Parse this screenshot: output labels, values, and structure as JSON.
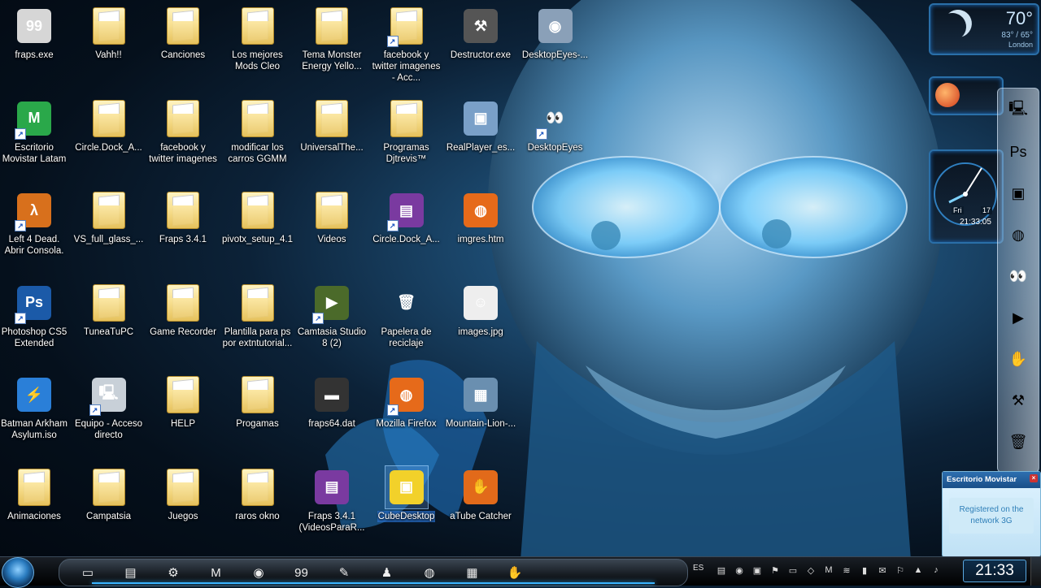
{
  "desktop": {
    "icons": [
      {
        "label": "fraps.exe",
        "kind": "app",
        "glyph": "99",
        "color": "#d6d6d6",
        "shortcut": false,
        "col": 0,
        "row": 0
      },
      {
        "label": "Vahh!!",
        "kind": "folder",
        "col": 1,
        "row": 0
      },
      {
        "label": "Canciones",
        "kind": "folder",
        "col": 2,
        "row": 0
      },
      {
        "label": "Los mejores Mods Cleo",
        "kind": "folder",
        "col": 3,
        "row": 0
      },
      {
        "label": "Tema Monster Energy Yello...",
        "kind": "folder",
        "col": 4,
        "row": 0
      },
      {
        "label": "facebook y twitter imagenes - Acc...",
        "kind": "folder",
        "shortcut": true,
        "col": 5,
        "row": 0
      },
      {
        "label": "Destructor.exe",
        "kind": "app",
        "glyph": "⚒",
        "color": "#555",
        "col": 6,
        "row": 0
      },
      {
        "label": "DesktopEyes-...",
        "kind": "app",
        "glyph": "◉",
        "color": "#8aa0b8",
        "col": 7,
        "row": 0
      },
      {
        "label": "Escritorio Movistar Latam",
        "kind": "app",
        "glyph": "M",
        "color": "#2aa84a",
        "shortcut": true,
        "col": 0,
        "row": 1
      },
      {
        "label": "Circle.Dock_A...",
        "kind": "folder",
        "col": 1,
        "row": 1
      },
      {
        "label": "facebook y twitter imagenes",
        "kind": "folder",
        "col": 2,
        "row": 1
      },
      {
        "label": "modificar los carros GGMM",
        "kind": "folder",
        "col": 3,
        "row": 1
      },
      {
        "label": "UniversalThe...",
        "kind": "folder",
        "col": 4,
        "row": 1
      },
      {
        "label": "Programas Djtrevis™",
        "kind": "folder",
        "col": 5,
        "row": 1
      },
      {
        "label": "RealPlayer_es...",
        "kind": "app",
        "glyph": "▣",
        "color": "#7aa0c8",
        "col": 6,
        "row": 1
      },
      {
        "label": "DesktopEyes",
        "kind": "app",
        "glyph": "👀",
        "color": "transparent",
        "shortcut": true,
        "col": 7,
        "row": 1
      },
      {
        "label": "Left 4 Dead. Abrir Consola.",
        "kind": "app",
        "glyph": "λ",
        "color": "#d8701c",
        "shortcut": true,
        "col": 0,
        "row": 2
      },
      {
        "label": "VS_full_glass_...",
        "kind": "folder",
        "col": 1,
        "row": 2
      },
      {
        "label": "Fraps 3.4.1",
        "kind": "folder",
        "col": 2,
        "row": 2
      },
      {
        "label": "pivotx_setup_4.1",
        "kind": "folder",
        "col": 3,
        "row": 2
      },
      {
        "label": "Videos",
        "kind": "folder",
        "col": 4,
        "row": 2
      },
      {
        "label": "Circle.Dock_A...",
        "kind": "app",
        "glyph": "▤",
        "color": "#7a3aa0",
        "shortcut": true,
        "col": 5,
        "row": 2
      },
      {
        "label": "imgres.htm",
        "kind": "app",
        "glyph": "◍",
        "color": "#e66a1a",
        "col": 6,
        "row": 2
      },
      {
        "label": "Photoshop CS5 Extended",
        "kind": "app",
        "glyph": "Ps",
        "color": "#1b5aa8",
        "shortcut": true,
        "col": 0,
        "row": 3
      },
      {
        "label": "TuneaTuPC",
        "kind": "folder",
        "col": 1,
        "row": 3
      },
      {
        "label": "Game Recorder",
        "kind": "folder",
        "col": 2,
        "row": 3
      },
      {
        "label": "Plantilla para ps por extntutorial...",
        "kind": "folder",
        "col": 3,
        "row": 3
      },
      {
        "label": "Camtasia Studio 8 (2)",
        "kind": "app",
        "glyph": "▶",
        "color": "#4b6a2a",
        "shortcut": true,
        "col": 4,
        "row": 3
      },
      {
        "label": "Papelera de reciclaje",
        "kind": "app",
        "glyph": "🗑",
        "color": "transparent",
        "col": 5,
        "row": 3
      },
      {
        "label": "images.jpg",
        "kind": "app",
        "glyph": "☺",
        "color": "#eee",
        "col": 6,
        "row": 3
      },
      {
        "label": "Batman Arkham Asylum.iso",
        "kind": "app",
        "glyph": "⚡",
        "color": "#2a7fd8",
        "col": 0,
        "row": 4
      },
      {
        "label": "Equipo - Acceso directo",
        "kind": "app",
        "glyph": "🖳",
        "color": "#c8d0d8",
        "shortcut": true,
        "col": 1,
        "row": 4
      },
      {
        "label": "HELP",
        "kind": "folder",
        "col": 2,
        "row": 4
      },
      {
        "label": "Progamas",
        "kind": "folder",
        "col": 3,
        "row": 4
      },
      {
        "label": "fraps64.dat",
        "kind": "app",
        "glyph": "▬",
        "color": "#333",
        "col": 4,
        "row": 4
      },
      {
        "label": "Mozilla Firefox",
        "kind": "app",
        "glyph": "◍",
        "color": "#e66a1a",
        "shortcut": true,
        "col": 5,
        "row": 4
      },
      {
        "label": "Mountain-Lion-...",
        "kind": "app",
        "glyph": "▦",
        "color": "#6a8fb0",
        "col": 6,
        "row": 4
      },
      {
        "label": "Animaciones",
        "kind": "folder",
        "col": 0,
        "row": 5
      },
      {
        "label": "Campatsia",
        "kind": "folder",
        "col": 1,
        "row": 5
      },
      {
        "label": "Juegos",
        "kind": "folder",
        "col": 2,
        "row": 5
      },
      {
        "label": "raros okno",
        "kind": "folder",
        "col": 3,
        "row": 5
      },
      {
        "label": "Fraps 3.4.1 (VideosParaR...",
        "kind": "app",
        "glyph": "▤",
        "color": "#7a3aa0",
        "col": 4,
        "row": 5
      },
      {
        "label": "CubeDesktop",
        "kind": "app",
        "glyph": "▣",
        "color": "#f2d12a",
        "selected": true,
        "col": 5,
        "row": 5
      },
      {
        "label": "aTube Catcher",
        "kind": "app",
        "glyph": "✋",
        "color": "#e26a1a",
        "col": 6,
        "row": 5
      }
    ]
  },
  "weather": {
    "temp": "70°",
    "range": "83° / 65°",
    "city": "London"
  },
  "clock_gadget": {
    "day": "Fri",
    "date": "17",
    "time": "21:33:05"
  },
  "dock_right_items": [
    {
      "name": "computer-icon",
      "glyph": "🖳"
    },
    {
      "name": "photoshop-icon",
      "glyph": "Ps"
    },
    {
      "name": "cube-icon",
      "glyph": "▣"
    },
    {
      "name": "firefox-icon",
      "glyph": "◍"
    },
    {
      "name": "eyes-icon",
      "glyph": "👀"
    },
    {
      "name": "camtasia-icon",
      "glyph": "▶"
    },
    {
      "name": "atube-icon",
      "glyph": "✋"
    },
    {
      "name": "destructor-icon",
      "glyph": "⚒"
    },
    {
      "name": "recycle-bin-icon",
      "glyph": "🗑"
    }
  ],
  "notification": {
    "title": "Escritorio Movistar",
    "close": "×",
    "body": "Registered on the network 3G"
  },
  "taskbar": {
    "items": [
      {
        "name": "folder-icon",
        "glyph": "▭"
      },
      {
        "name": "explorer-icon",
        "glyph": "▤"
      },
      {
        "name": "tools-icon",
        "glyph": "⚙"
      },
      {
        "name": "movistar-icon",
        "glyph": "M"
      },
      {
        "name": "chrome-icon",
        "glyph": "◉"
      },
      {
        "name": "fraps-icon",
        "glyph": "99"
      },
      {
        "name": "edit-icon",
        "glyph": "✎"
      },
      {
        "name": "game-icon",
        "glyph": "♟"
      },
      {
        "name": "firefox-icon",
        "glyph": "◍"
      },
      {
        "name": "flag-icon",
        "glyph": "▦"
      },
      {
        "name": "atube-icon",
        "glyph": "✋"
      }
    ],
    "language": "ES",
    "clock": "21:33"
  },
  "colors": {
    "accent": "#3ab4ff",
    "folder": "#f3d77b"
  }
}
